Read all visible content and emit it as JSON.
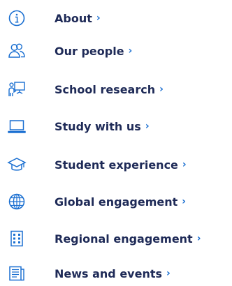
{
  "menu": {
    "items": [
      {
        "label": "About",
        "icon": "info-circle-icon"
      },
      {
        "label": "Our people",
        "icon": "people-icon"
      },
      {
        "label": "School research",
        "icon": "presentation-icon"
      },
      {
        "label": "Study with us",
        "icon": "laptop-icon"
      },
      {
        "label": "Student experience",
        "icon": "graduation-cap-icon"
      },
      {
        "label": "Global engagement",
        "icon": "globe-icon"
      },
      {
        "label": "Regional engagement",
        "icon": "building-icon"
      },
      {
        "label": "News and events",
        "icon": "newspaper-icon"
      }
    ],
    "chevron": "›"
  },
  "colors": {
    "icon": "#1a6fd1",
    "text": "#1e2a57",
    "chevron": "#1a6fd1"
  }
}
